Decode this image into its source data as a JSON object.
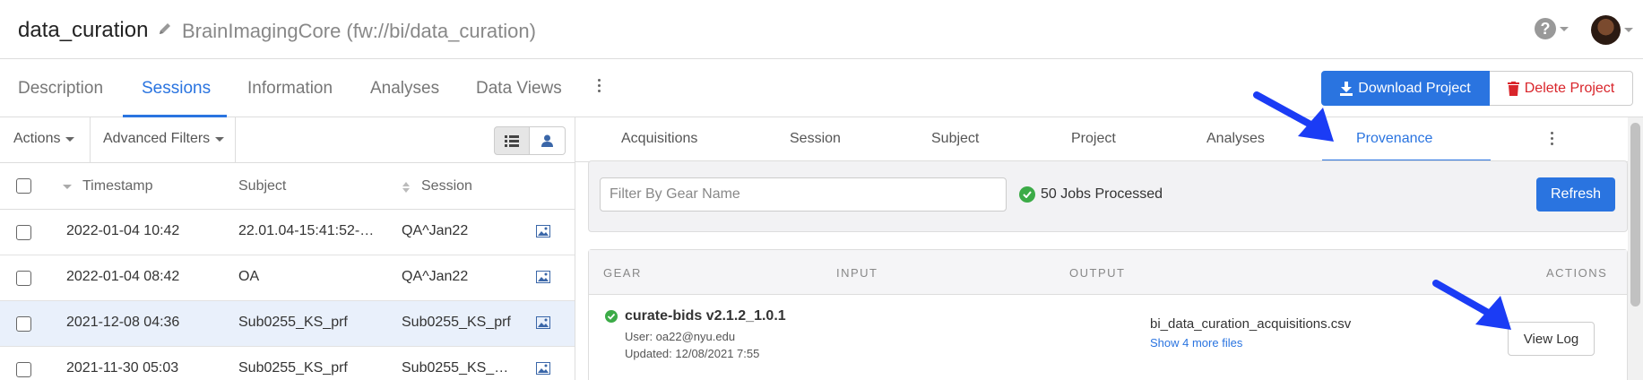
{
  "header": {
    "title": "data_curation",
    "path": "BrainImagingCore (fw://bi/data_curation)"
  },
  "main_tabs": [
    {
      "label": "Description"
    },
    {
      "label": "Sessions"
    },
    {
      "label": "Information"
    },
    {
      "label": "Analyses"
    },
    {
      "label": "Data Views"
    }
  ],
  "actions": {
    "download_label": "Download Project",
    "delete_label": "Delete Project"
  },
  "sessions_panel": {
    "actions_label": "Actions",
    "advanced_filters_label": "Advanced Filters",
    "columns": {
      "timestamp": "Timestamp",
      "subject": "Subject",
      "session": "Session"
    },
    "rows": [
      {
        "timestamp": "2022-01-04 10:42",
        "subject": "22.01.04-15:41:52-…",
        "session": "QA^Jan22"
      },
      {
        "timestamp": "2022-01-04 08:42",
        "subject": "OA",
        "session": "QA^Jan22"
      },
      {
        "timestamp": "2021-12-08 04:36",
        "subject": "Sub0255_KS_prf",
        "session": "Sub0255_KS_prf"
      },
      {
        "timestamp": "2021-11-30 05:03",
        "subject": "Sub0255_KS_prf",
        "session": "Sub0255_KS_…"
      }
    ]
  },
  "detail_tabs": [
    {
      "label": "Acquisitions"
    },
    {
      "label": "Session"
    },
    {
      "label": "Subject"
    },
    {
      "label": "Project"
    },
    {
      "label": "Analyses"
    },
    {
      "label": "Provenance"
    }
  ],
  "provenance": {
    "filter_placeholder": "Filter By Gear Name",
    "jobs_processed": "50 Jobs Processed",
    "refresh_label": "Refresh",
    "columns": {
      "gear": "GEAR",
      "input": "INPUT",
      "output": "OUTPUT",
      "actions": "ACTIONS"
    },
    "job": {
      "gear": "curate-bids v2.1.2_1.0.1",
      "user": "User: oa22@nyu.edu",
      "updated": "Updated: 12/08/2021 7:55",
      "output_file": "bi_data_curation_acquisitions.csv",
      "more_files": "Show 4 more files",
      "view_log_label": "View Log"
    }
  },
  "colors": {
    "accent": "#2a74e0",
    "danger": "#d9252b",
    "success": "#3cab47",
    "selected_row": "#e9f0fb"
  },
  "icons": [
    "pencil-icon",
    "help-icon",
    "download-icon",
    "trash-icon",
    "list-view-icon",
    "user-view-icon",
    "image-icon",
    "check-circle-icon",
    "kebab-icon",
    "annotation-arrow-icon"
  ]
}
